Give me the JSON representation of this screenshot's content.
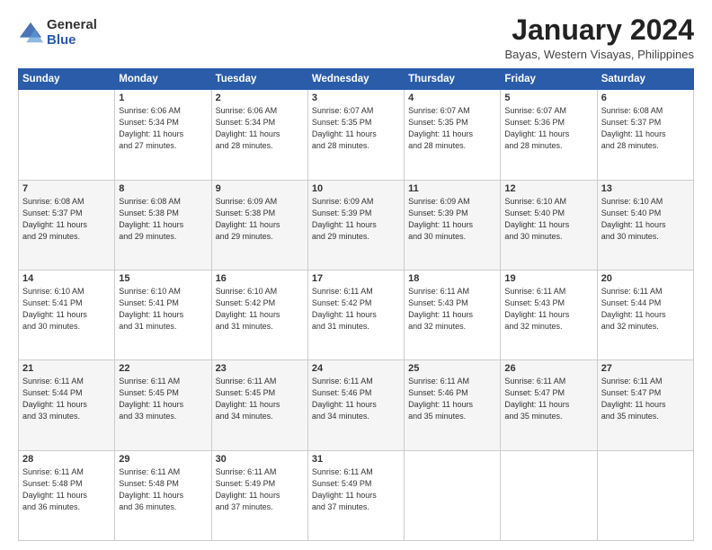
{
  "header": {
    "logo_general": "General",
    "logo_blue": "Blue",
    "month_title": "January 2024",
    "location": "Bayas, Western Visayas, Philippines"
  },
  "weekdays": [
    "Sunday",
    "Monday",
    "Tuesday",
    "Wednesday",
    "Thursday",
    "Friday",
    "Saturday"
  ],
  "weeks": [
    [
      {
        "day": "",
        "info": ""
      },
      {
        "day": "1",
        "info": "Sunrise: 6:06 AM\nSunset: 5:34 PM\nDaylight: 11 hours\nand 27 minutes."
      },
      {
        "day": "2",
        "info": "Sunrise: 6:06 AM\nSunset: 5:34 PM\nDaylight: 11 hours\nand 28 minutes."
      },
      {
        "day": "3",
        "info": "Sunrise: 6:07 AM\nSunset: 5:35 PM\nDaylight: 11 hours\nand 28 minutes."
      },
      {
        "day": "4",
        "info": "Sunrise: 6:07 AM\nSunset: 5:35 PM\nDaylight: 11 hours\nand 28 minutes."
      },
      {
        "day": "5",
        "info": "Sunrise: 6:07 AM\nSunset: 5:36 PM\nDaylight: 11 hours\nand 28 minutes."
      },
      {
        "day": "6",
        "info": "Sunrise: 6:08 AM\nSunset: 5:37 PM\nDaylight: 11 hours\nand 28 minutes."
      }
    ],
    [
      {
        "day": "7",
        "info": "Sunrise: 6:08 AM\nSunset: 5:37 PM\nDaylight: 11 hours\nand 29 minutes."
      },
      {
        "day": "8",
        "info": "Sunrise: 6:08 AM\nSunset: 5:38 PM\nDaylight: 11 hours\nand 29 minutes."
      },
      {
        "day": "9",
        "info": "Sunrise: 6:09 AM\nSunset: 5:38 PM\nDaylight: 11 hours\nand 29 minutes."
      },
      {
        "day": "10",
        "info": "Sunrise: 6:09 AM\nSunset: 5:39 PM\nDaylight: 11 hours\nand 29 minutes."
      },
      {
        "day": "11",
        "info": "Sunrise: 6:09 AM\nSunset: 5:39 PM\nDaylight: 11 hours\nand 30 minutes."
      },
      {
        "day": "12",
        "info": "Sunrise: 6:10 AM\nSunset: 5:40 PM\nDaylight: 11 hours\nand 30 minutes."
      },
      {
        "day": "13",
        "info": "Sunrise: 6:10 AM\nSunset: 5:40 PM\nDaylight: 11 hours\nand 30 minutes."
      }
    ],
    [
      {
        "day": "14",
        "info": "Sunrise: 6:10 AM\nSunset: 5:41 PM\nDaylight: 11 hours\nand 30 minutes."
      },
      {
        "day": "15",
        "info": "Sunrise: 6:10 AM\nSunset: 5:41 PM\nDaylight: 11 hours\nand 31 minutes."
      },
      {
        "day": "16",
        "info": "Sunrise: 6:10 AM\nSunset: 5:42 PM\nDaylight: 11 hours\nand 31 minutes."
      },
      {
        "day": "17",
        "info": "Sunrise: 6:11 AM\nSunset: 5:42 PM\nDaylight: 11 hours\nand 31 minutes."
      },
      {
        "day": "18",
        "info": "Sunrise: 6:11 AM\nSunset: 5:43 PM\nDaylight: 11 hours\nand 32 minutes."
      },
      {
        "day": "19",
        "info": "Sunrise: 6:11 AM\nSunset: 5:43 PM\nDaylight: 11 hours\nand 32 minutes."
      },
      {
        "day": "20",
        "info": "Sunrise: 6:11 AM\nSunset: 5:44 PM\nDaylight: 11 hours\nand 32 minutes."
      }
    ],
    [
      {
        "day": "21",
        "info": "Sunrise: 6:11 AM\nSunset: 5:44 PM\nDaylight: 11 hours\nand 33 minutes."
      },
      {
        "day": "22",
        "info": "Sunrise: 6:11 AM\nSunset: 5:45 PM\nDaylight: 11 hours\nand 33 minutes."
      },
      {
        "day": "23",
        "info": "Sunrise: 6:11 AM\nSunset: 5:45 PM\nDaylight: 11 hours\nand 34 minutes."
      },
      {
        "day": "24",
        "info": "Sunrise: 6:11 AM\nSunset: 5:46 PM\nDaylight: 11 hours\nand 34 minutes."
      },
      {
        "day": "25",
        "info": "Sunrise: 6:11 AM\nSunset: 5:46 PM\nDaylight: 11 hours\nand 35 minutes."
      },
      {
        "day": "26",
        "info": "Sunrise: 6:11 AM\nSunset: 5:47 PM\nDaylight: 11 hours\nand 35 minutes."
      },
      {
        "day": "27",
        "info": "Sunrise: 6:11 AM\nSunset: 5:47 PM\nDaylight: 11 hours\nand 35 minutes."
      }
    ],
    [
      {
        "day": "28",
        "info": "Sunrise: 6:11 AM\nSunset: 5:48 PM\nDaylight: 11 hours\nand 36 minutes."
      },
      {
        "day": "29",
        "info": "Sunrise: 6:11 AM\nSunset: 5:48 PM\nDaylight: 11 hours\nand 36 minutes."
      },
      {
        "day": "30",
        "info": "Sunrise: 6:11 AM\nSunset: 5:49 PM\nDaylight: 11 hours\nand 37 minutes."
      },
      {
        "day": "31",
        "info": "Sunrise: 6:11 AM\nSunset: 5:49 PM\nDaylight: 11 hours\nand 37 minutes."
      },
      {
        "day": "",
        "info": ""
      },
      {
        "day": "",
        "info": ""
      },
      {
        "day": "",
        "info": ""
      }
    ]
  ]
}
